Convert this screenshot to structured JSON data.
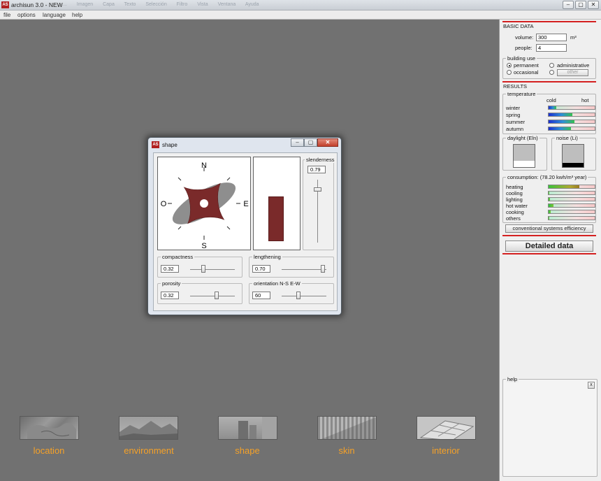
{
  "window": {
    "title": "archisun 3.0 - NEW",
    "ghost_menu": [
      "...",
      "Imagen",
      "Capa",
      "Texto",
      "Selección",
      "Filtro",
      "Vista",
      "Ventana",
      "Ayuda"
    ],
    "controls": {
      "minimize": "–",
      "maximize": "▢",
      "close": "✕"
    }
  },
  "menubar": [
    "file",
    "options",
    "language",
    "help"
  ],
  "basic_data": {
    "heading": "BASIC DATA",
    "volume_label": "volume:",
    "volume_value": "300",
    "volume_unit": "m³",
    "people_label": "people:",
    "people_value": "4",
    "building_use": {
      "legend": "building use",
      "options": [
        "permanent",
        "administrative",
        "occasional"
      ],
      "other_label": "other",
      "selected": "permanent"
    }
  },
  "results": {
    "heading": "RESULTS",
    "temperature": {
      "legend": "temperature",
      "cold_label": "cold",
      "hot_label": "hot",
      "rows": [
        {
          "label": "winter",
          "level": 0.16
        },
        {
          "label": "spring",
          "level": 0.52
        },
        {
          "label": "summer",
          "level": 0.56
        },
        {
          "label": "autumn",
          "level": 0.48
        }
      ]
    },
    "daylight": {
      "legend": "daylight (Eln)",
      "level": 0.28
    },
    "noise": {
      "legend": "noise (Li)",
      "level": 0.18
    },
    "consumption": {
      "legend": "consumption: (78.20 kwh/m³ year)",
      "rows": [
        {
          "label": "heating",
          "level": 0.66
        },
        {
          "label": "cooling",
          "level": 0.02
        },
        {
          "label": "lighting",
          "level": 0.03
        },
        {
          "label": "hot water",
          "level": 0.1
        },
        {
          "label": "cooking",
          "level": 0.04
        },
        {
          "label": "others",
          "level": 0.02
        }
      ]
    },
    "efficiency_button": "conventional systems efficiency",
    "detailed_button": "Detailed data"
  },
  "help_panel": {
    "legend": "help",
    "close": "x"
  },
  "shape_dialog": {
    "title": "shape",
    "compass": {
      "n": "N",
      "s": "S",
      "e": "E",
      "w": "O"
    },
    "slenderness": {
      "label": "slenderness",
      "value": "0.79",
      "level": 0.16
    },
    "compactness": {
      "label": "compactness",
      "value": "0.32",
      "level": 0.3
    },
    "lengthening": {
      "label": "lengthening",
      "value": "0.70",
      "level": 0.92
    },
    "porosity": {
      "label": "porosity",
      "value": "0.32",
      "level": 0.6
    },
    "orientation": {
      "label": "orientation N-S  E-W",
      "value": "60",
      "level": 0.38
    }
  },
  "nav": [
    {
      "label": "location",
      "icon": "map-thumbnail"
    },
    {
      "label": "environment",
      "icon": "mountain-thumbnail"
    },
    {
      "label": "shape",
      "icon": "building-thumbnail"
    },
    {
      "label": "skin",
      "icon": "facade-thumbnail"
    },
    {
      "label": "interior",
      "icon": "interior-thumbnail"
    }
  ],
  "colors": {
    "accent_red": "#d42020",
    "nav_label": "#f5a128",
    "building": "#7a2a2a",
    "canvas": "#717171"
  }
}
